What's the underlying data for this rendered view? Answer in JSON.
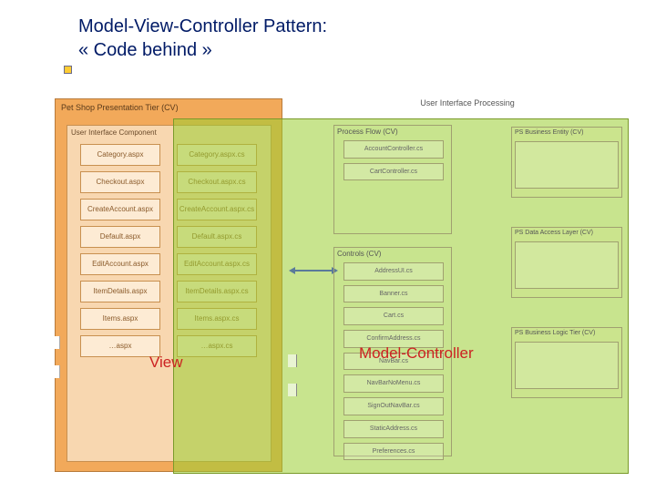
{
  "header": {
    "title_line1": "Model-View-Controller Pattern:",
    "title_line2": "« Code behind »"
  },
  "orange": {
    "panel_title": "Pet Shop Presentation Tier (CV)",
    "inner_title": "User Interface Component",
    "aspx": [
      "Category.aspx",
      "Checkout.aspx",
      "CreateAccount.aspx",
      "Default.aspx",
      "EditAccount.aspx",
      "ItemDetails.aspx",
      "Items.aspx",
      "…aspx"
    ],
    "aspxcs": [
      "Category.aspx.cs",
      "Checkout.aspx.cs",
      "CreateAccount.aspx.cs",
      "Default.aspx.cs",
      "EditAccount.aspx.cs",
      "ItemDetails.aspx.cs",
      "Items.aspx.cs",
      "…aspx.cs"
    ]
  },
  "ui_proc_title": "User Interface Processing",
  "process_flow": {
    "title": "Process Flow (CV)",
    "items": [
      "AccountController.cs",
      "CartController.cs"
    ]
  },
  "controls": {
    "title": "Controls (CV)",
    "items": [
      "AddressUI.cs",
      "Banner.cs",
      "Cart.cs",
      "ConfirmAddress.cs",
      "NavBar.cs",
      "NavBarNoMenu.cs",
      "SignOutNavBar.cs",
      "StaticAddress.cs",
      "Preferences.cs"
    ]
  },
  "right": [
    {
      "title": "PS Business Entity (CV)"
    },
    {
      "title": "PS Data Access Layer (CV)"
    },
    {
      "title": "PS Business Logic Tier (CV)"
    }
  ],
  "labels": {
    "view": "View",
    "mc": "Model-Controller"
  }
}
